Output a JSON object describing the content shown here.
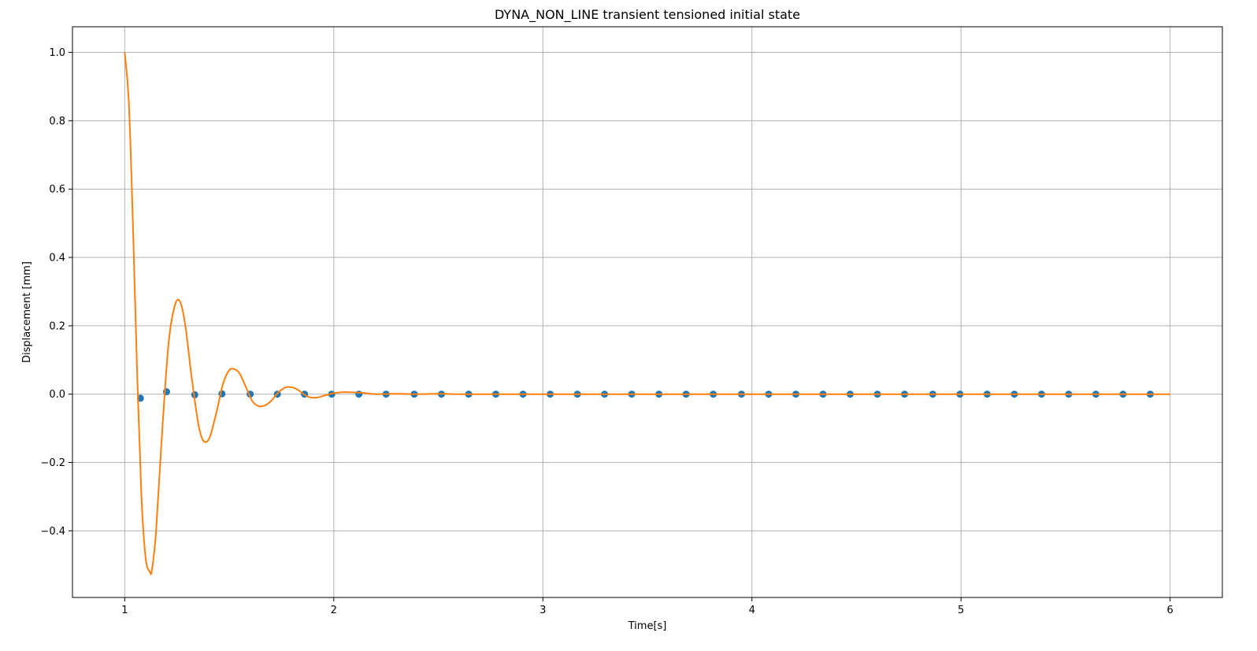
{
  "chart_data": {
    "type": "line",
    "title": "DYNA_NON_LINE transient tensioned initial state",
    "xlabel": "Time[s]",
    "ylabel": "Displacement [mm]",
    "xlim": [
      0.75,
      6.25
    ],
    "ylim": [
      -0.595,
      1.075
    ],
    "grid": true,
    "x_ticks": [
      1,
      2,
      3,
      4,
      5,
      6
    ],
    "x_tick_labels": [
      "1",
      "2",
      "3",
      "4",
      "5",
      "6"
    ],
    "y_ticks": [
      -0.4,
      -0.2,
      0.0,
      0.2,
      0.4,
      0.6,
      0.8,
      1.0
    ],
    "y_tick_labels": [
      "−0.4",
      "−0.2",
      "0.0",
      "0.2",
      "0.4",
      "0.6",
      "0.8",
      "1.0"
    ],
    "colors": {
      "line": "#ff7f0e",
      "points": "#1f77b4",
      "grid": "#b0b0b0"
    },
    "series": [
      {
        "style": "line",
        "x": [
          1.0,
          1.02,
          1.04,
          1.06,
          1.08,
          1.1,
          1.12,
          1.13,
          1.15,
          1.18,
          1.21,
          1.24,
          1.265,
          1.29,
          1.32,
          1.35,
          1.37,
          1.39,
          1.41,
          1.44,
          1.47,
          1.5,
          1.525,
          1.55,
          1.58,
          1.61,
          1.64,
          1.67,
          1.7,
          1.735,
          1.77,
          1.8,
          1.83,
          1.86,
          1.89,
          1.92,
          1.95,
          1.98,
          2.0,
          2.05,
          2.1,
          2.15,
          2.2,
          2.3,
          2.4,
          2.5,
          2.6,
          2.7,
          2.8,
          3.0,
          3.5,
          4.0,
          4.5,
          5.0,
          5.5,
          6.0
        ],
        "y": [
          1.0,
          0.85,
          0.48,
          0.05,
          -0.3,
          -0.48,
          -0.52,
          -0.515,
          -0.4,
          -0.1,
          0.15,
          0.26,
          0.27,
          0.2,
          0.05,
          -0.08,
          -0.13,
          -0.14,
          -0.12,
          -0.05,
          0.03,
          0.07,
          0.073,
          0.06,
          0.02,
          -0.02,
          -0.035,
          -0.033,
          -0.02,
          0.005,
          0.02,
          0.02,
          0.012,
          -0.002,
          -0.01,
          -0.01,
          -0.005,
          0.0,
          0.003,
          0.006,
          0.005,
          0.003,
          0.0,
          0.001,
          0.0,
          0.001,
          0.0,
          0.0,
          0.0,
          0.0,
          0.0,
          0.0,
          0.0,
          0.0,
          0.0,
          0.0
        ]
      },
      {
        "style": "scatter",
        "x": [
          1.075,
          1.2,
          1.335,
          1.465,
          1.6,
          1.73,
          1.86,
          1.99,
          2.12,
          2.25,
          2.385,
          2.515,
          2.645,
          2.775,
          2.905,
          3.035,
          3.165,
          3.295,
          3.425,
          3.555,
          3.685,
          3.815,
          3.95,
          4.08,
          4.21,
          4.34,
          4.47,
          4.6,
          4.73,
          4.865,
          4.995,
          5.125,
          5.255,
          5.385,
          5.515,
          5.645,
          5.775,
          5.905
        ],
        "y": [
          -0.012,
          0.007,
          -0.002,
          0.001,
          0.0,
          0.0,
          0.0,
          0.0,
          0.0,
          0.0,
          0.0,
          0.0,
          0.0,
          0.0,
          0.0,
          0.0,
          0.0,
          0.0,
          0.0,
          0.0,
          0.0,
          0.0,
          0.0,
          0.0,
          0.0,
          0.0,
          0.0,
          0.0,
          0.0,
          0.0,
          0.0,
          0.0,
          0.0,
          0.0,
          0.0,
          0.0,
          0.0,
          0.0
        ]
      }
    ]
  }
}
